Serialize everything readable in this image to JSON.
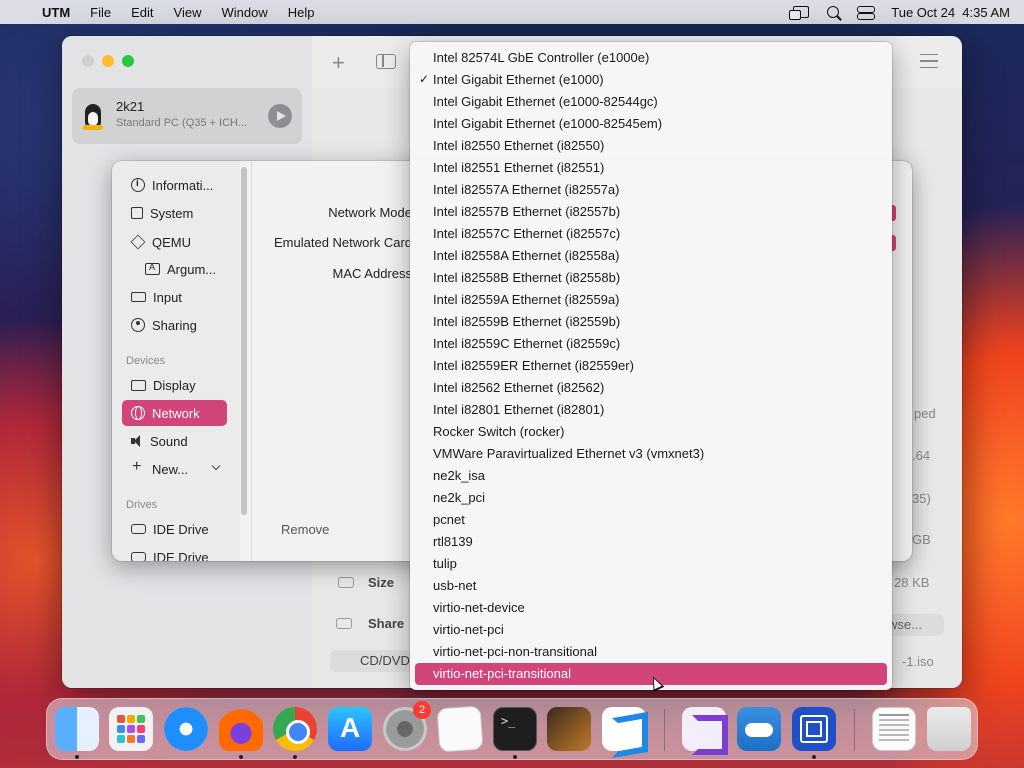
{
  "menubar": {
    "app_name": "UTM",
    "items": [
      "File",
      "Edit",
      "View",
      "Window",
      "Help"
    ],
    "clock": "Tue Oct 24  4:35 AM"
  },
  "utm": {
    "vm_name": "2k21",
    "vm_desc": "Standard PC (Q35 + ICH...",
    "size_label": "Size",
    "shared_label": "Share",
    "cd_label": "CD/DVD",
    "browse_label": "wse...",
    "right_values": [
      "ped",
      ".64",
      "35)",
      "GB",
      "28 KB",
      "-1.iso"
    ]
  },
  "sheet": {
    "nav": {
      "information": "Informati...",
      "system": "System",
      "qemu": "QEMU",
      "arguments": "Argum...",
      "input": "Input",
      "sharing": "Sharing",
      "devices_header": "Devices",
      "display": "Display",
      "network": "Network",
      "sound": "Sound",
      "new": "New...",
      "drives_header": "Drives",
      "drive1": "IDE Drive",
      "drive2": "IDE Drive"
    },
    "form": {
      "network_mode": "Network Mode",
      "emulated_card": "Emulated Network Card",
      "mac_address": "MAC Address"
    },
    "remove_label": "Remove"
  },
  "dropdown": {
    "checked_index": 1,
    "highlighted_index": 28,
    "options": [
      "Intel 82574L GbE Controller (e1000e)",
      "Intel Gigabit Ethernet (e1000)",
      "Intel Gigabit Ethernet (e1000-82544gc)",
      "Intel Gigabit Ethernet (e1000-82545em)",
      "Intel i82550 Ethernet (i82550)",
      "Intel i82551 Ethernet (i82551)",
      "Intel i82557A Ethernet (i82557a)",
      "Intel i82557B Ethernet (i82557b)",
      "Intel i82557C Ethernet (i82557c)",
      "Intel i82558A Ethernet (i82558a)",
      "Intel i82558B Ethernet (i82558b)",
      "Intel i82559A Ethernet (i82559a)",
      "Intel i82559B Ethernet (i82559b)",
      "Intel i82559C Ethernet (i82559c)",
      "Intel i82559ER Ethernet (i82559er)",
      "Intel i82562 Ethernet (i82562)",
      "Intel i82801 Ethernet (i82801)",
      "Rocker Switch (rocker)",
      "VMWare Paravirtualized Ethernet v3 (vmxnet3)",
      "ne2k_isa",
      "ne2k_pci",
      "pcnet",
      "rtl8139",
      "tulip",
      "usb-net",
      "virtio-net-device",
      "virtio-net-pci",
      "virtio-net-pci-non-transitional",
      "virtio-net-pci-transitional"
    ]
  },
  "dock": {
    "apps": [
      "finder",
      "launchpad",
      "safari",
      "firefox",
      "chrome",
      "app-store",
      "system-settings",
      "textedit",
      "terminal",
      "garageband",
      "vscode",
      "visual-studio",
      "weather",
      "utm",
      "document",
      "trash"
    ],
    "settings_badge": "2"
  },
  "colors": {
    "accent": "#d2457a"
  }
}
